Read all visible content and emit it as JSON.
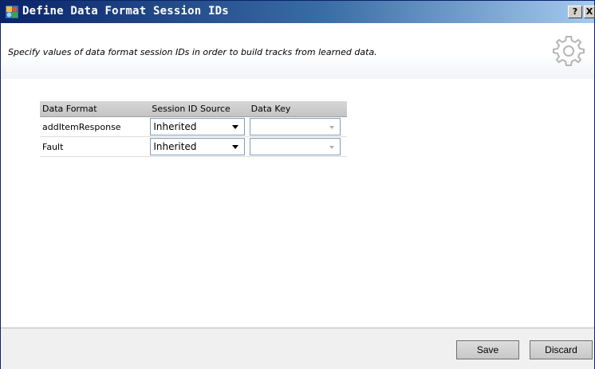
{
  "window": {
    "title": "Define Data Format Session IDs",
    "help_label": "?",
    "close_label": "X",
    "icon": "app-icon"
  },
  "header": {
    "description": "Specify values of data format session IDs in order to build tracks from learned data.",
    "icon": "gear-icon"
  },
  "grid": {
    "columns": [
      "Data Format",
      "Session ID Source",
      "Data Key"
    ],
    "rows": [
      {
        "data_format": "addItemResponse",
        "session_id_source": "Inherited",
        "data_key": ""
      },
      {
        "data_format": "Fault",
        "session_id_source": "Inherited",
        "data_key": ""
      }
    ]
  },
  "footer": {
    "save_label": "Save",
    "discard_label": "Discard"
  }
}
